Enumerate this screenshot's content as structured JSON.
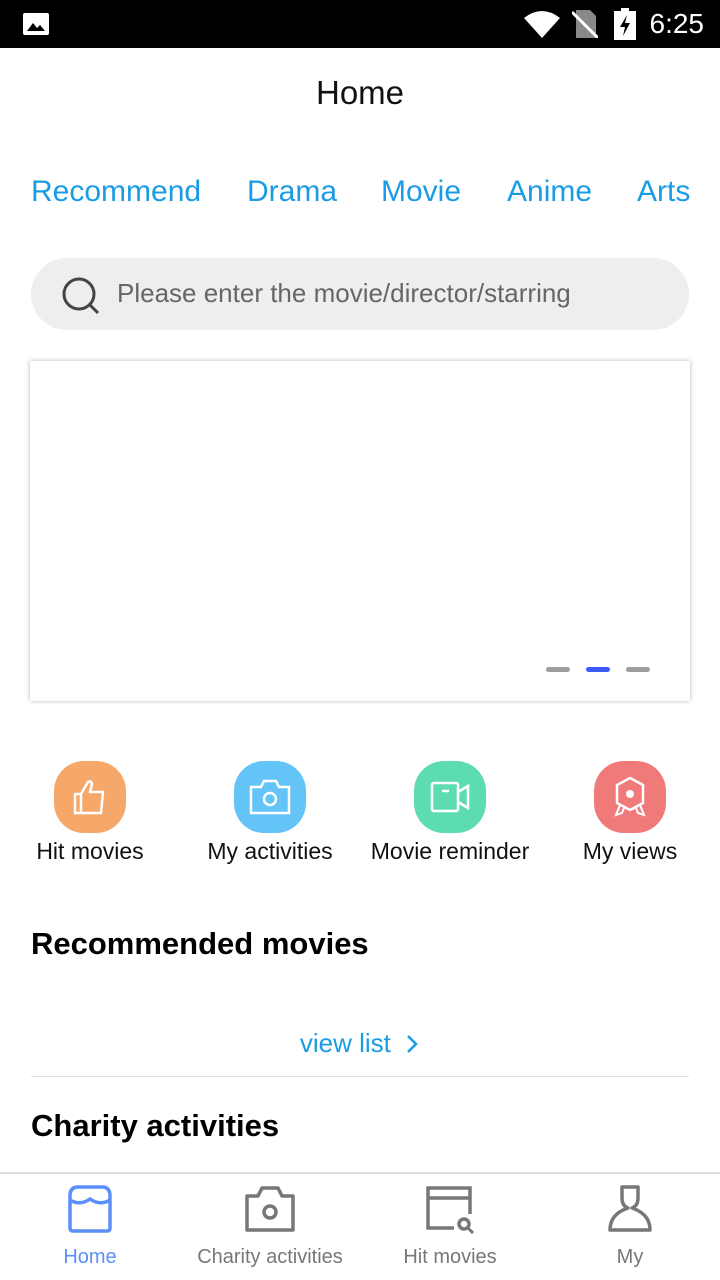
{
  "status_bar": {
    "time": "6:25"
  },
  "header": {
    "title": "Home"
  },
  "tabs": [
    {
      "label": "Recommend"
    },
    {
      "label": "Drama"
    },
    {
      "label": "Movie"
    },
    {
      "label": "Anime"
    },
    {
      "label": "Arts"
    }
  ],
  "search": {
    "placeholder": "Please enter the movie/director/starring"
  },
  "banner": {
    "page_count": 3,
    "active_page": 2,
    "active_color": "#3d5afe"
  },
  "quick_actions": [
    {
      "label": "Hit movies",
      "icon": "thumbs-up-icon",
      "color": "#f6a86a"
    },
    {
      "label": "My activities",
      "icon": "camera-icon",
      "color": "#64c4f7"
    },
    {
      "label": "Movie reminder",
      "icon": "video-icon",
      "color": "#5ddcb0"
    },
    {
      "label": "My views",
      "icon": "badge-icon",
      "color": "#f07a7a"
    }
  ],
  "sections": {
    "recommended": "Recommended movies",
    "view_list": "view list",
    "charity": "Charity activities"
  },
  "bottom_nav": {
    "active_color": "#5b8ff9",
    "items": [
      {
        "label": "Home",
        "icon": "store-icon"
      },
      {
        "label": "Charity activities",
        "icon": "camera-icon"
      },
      {
        "label": "Hit movies",
        "icon": "calendar-search-icon"
      },
      {
        "label": "My",
        "icon": "user-icon"
      }
    ]
  }
}
